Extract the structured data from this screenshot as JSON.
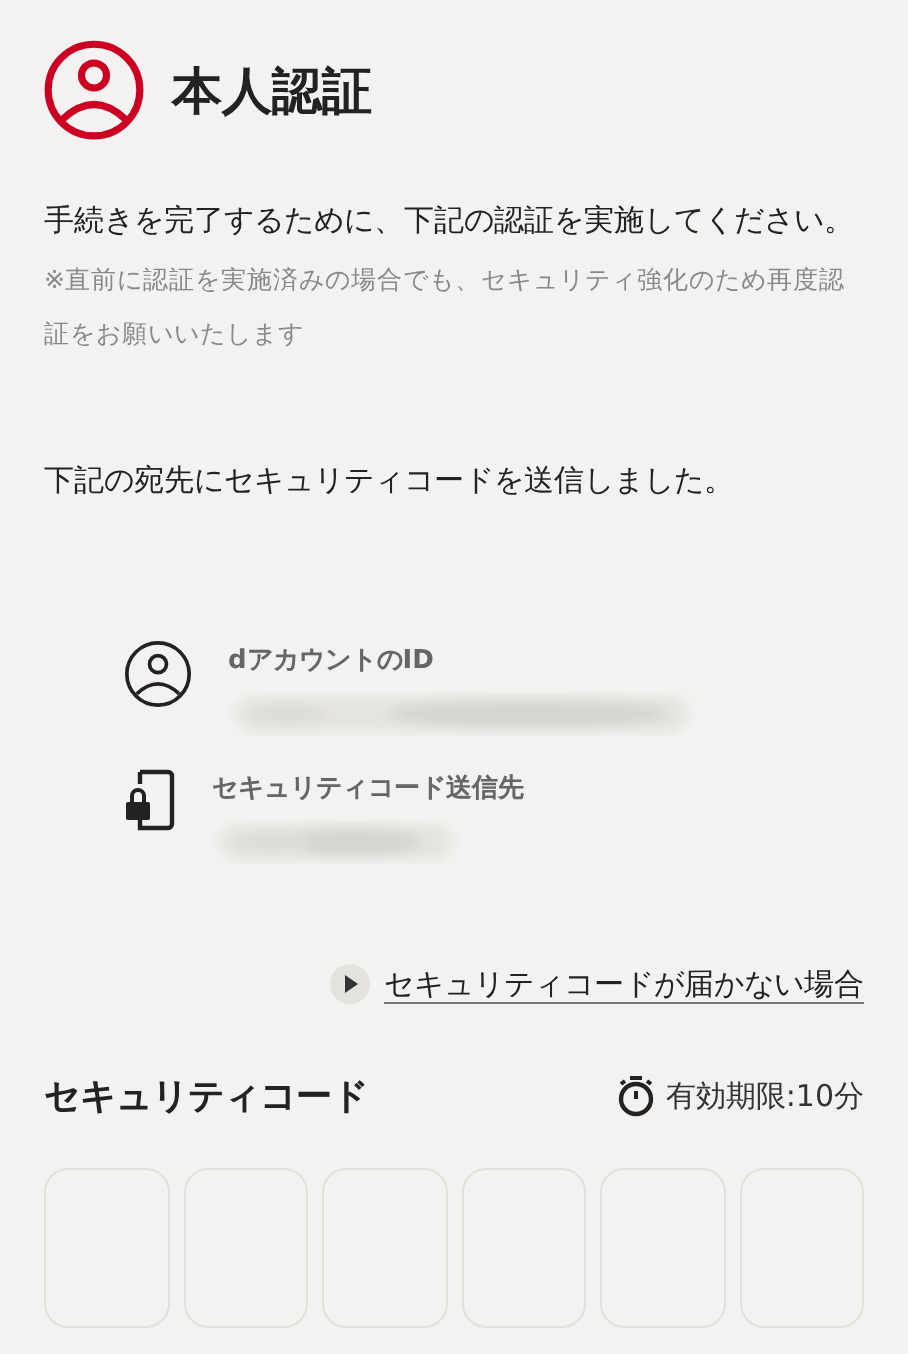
{
  "header": {
    "title": "本人認証"
  },
  "intro": "手続きを完了するために、下記の認証を実施してください。",
  "note": "※直前に認証を実施済みの場合でも、セキュリティ強化のため再度認証をお願いいたします",
  "sent_message": "下記の宛先にセキュリティコードを送信しました。",
  "destinations": [
    {
      "kind": "account",
      "label": "dアカウントのID",
      "value_redacted": true
    },
    {
      "kind": "phone",
      "label": "セキュリティコード送信先",
      "value_redacted": true
    }
  ],
  "help_link": "セキュリティコードが届かない場合",
  "code_section": {
    "title": "セキュリティコード",
    "expiry": "有効期限:10分"
  },
  "code_boxes": [
    {
      "filled": false
    },
    {
      "filled": false
    },
    {
      "filled": false
    },
    {
      "filled": false
    },
    {
      "filled": false
    },
    {
      "filled": false
    }
  ]
}
